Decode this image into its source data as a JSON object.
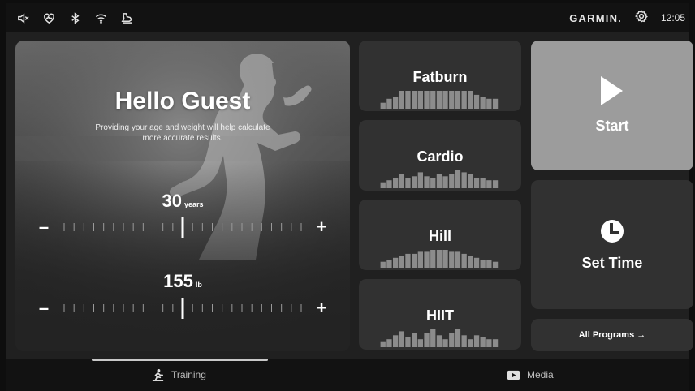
{
  "status_bar": {
    "icons": [
      "volume-mute-icon",
      "heart-rate-icon",
      "bluetooth-icon",
      "wifi-icon",
      "shoe-icon"
    ],
    "brand": "GARMIN.",
    "time": "12:05"
  },
  "hero": {
    "title": "Hello Guest",
    "subtitle": "Providing your age and weight will help calculate more accurate results.",
    "age": {
      "value": "30",
      "unit": "years"
    },
    "weight": {
      "value": "155",
      "unit": "lb"
    },
    "minus": "–",
    "plus": "+"
  },
  "programs": [
    {
      "name": "Fatburn",
      "profile": [
        3,
        5,
        6,
        9,
        9,
        9,
        9,
        9,
        9,
        9,
        9,
        9,
        9,
        9,
        9,
        7,
        6,
        5,
        5
      ]
    },
    {
      "name": "Cardio",
      "profile": [
        3,
        4,
        5,
        7,
        5,
        6,
        8,
        6,
        5,
        7,
        6,
        7,
        9,
        8,
        7,
        5,
        5,
        4,
        4
      ]
    },
    {
      "name": "Hill",
      "profile": [
        3,
        4,
        5,
        6,
        7,
        7,
        8,
        8,
        9,
        9,
        9,
        8,
        8,
        7,
        6,
        5,
        4,
        4,
        3
      ]
    },
    {
      "name": "HIIT",
      "profile": [
        3,
        4,
        6,
        8,
        5,
        7,
        4,
        7,
        9,
        6,
        4,
        7,
        9,
        6,
        4,
        6,
        5,
        4,
        4
      ]
    }
  ],
  "start_label": "Start",
  "set_time_label": "Set Time",
  "all_programs_label": "All Programs →",
  "nav": {
    "training": "Training",
    "media": "Media"
  }
}
